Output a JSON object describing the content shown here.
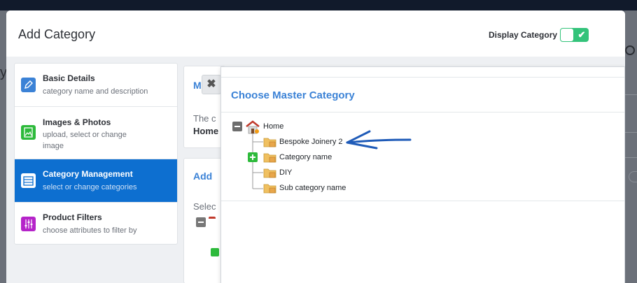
{
  "modal": {
    "title": "Add Category",
    "display_toggle_label": "Display Category",
    "display_toggle_on": true
  },
  "nav": {
    "items": [
      {
        "title": "Basic Details",
        "desc": "category name and description",
        "icon": "pencil-icon",
        "color": "#3b82d6",
        "active": false
      },
      {
        "title": "Images & Photos",
        "desc": "upload, select or change image",
        "icon": "image-icon",
        "color": "#2dba3b",
        "active": false
      },
      {
        "title": "Category Management",
        "desc": "select or change categories",
        "icon": "cabinet-icon",
        "color": "#ffffff",
        "active": true
      },
      {
        "title": "Product Filters",
        "desc": "choose attributes to filter by",
        "icon": "sliders-icon",
        "color": "#b524c9",
        "active": false
      }
    ]
  },
  "background_panels": {
    "master_heading_fragment": "Mas",
    "master_text_fragment": "The c",
    "master_value_fragment": "Home",
    "add_heading_fragment": "Add",
    "select_text_fragment": "Selec"
  },
  "popup": {
    "title": "Choose Master Category",
    "tree": {
      "root": {
        "label": "Home",
        "icon": "home-icon",
        "expanded": true
      },
      "children": [
        {
          "label": "Bespoke Joinery 2",
          "icon": "folder-icon",
          "toggle": "none"
        },
        {
          "label": "Category name",
          "icon": "folder-icon",
          "toggle": "plus"
        },
        {
          "label": "DIY",
          "icon": "folder-icon",
          "toggle": "none"
        },
        {
          "label": "Sub category name",
          "icon": "folder-icon",
          "toggle": "none"
        }
      ]
    }
  },
  "colors": {
    "accent": "#3b82d6",
    "active_nav": "#0d6fd0",
    "toggle_on": "#33c37a",
    "annotation_arrow": "#1f5bb8"
  }
}
